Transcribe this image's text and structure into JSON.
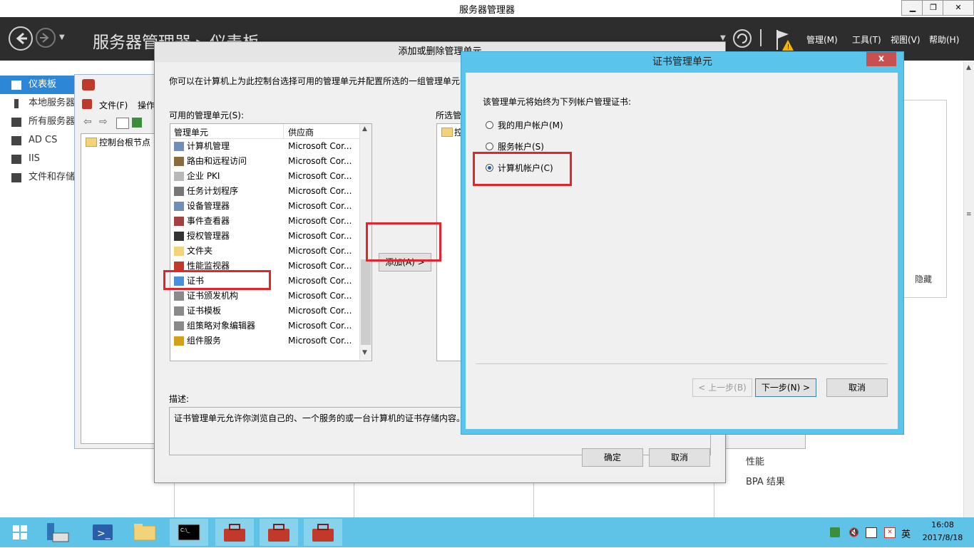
{
  "window": {
    "title": "服务器管理器"
  },
  "header": {
    "title": "服务器管理器 ▸ 仪表板",
    "menus": [
      "管理(M)",
      "工具(T)",
      "视图(V)",
      "帮助(H)"
    ]
  },
  "nav": {
    "items": [
      "仪表板",
      "本地服务器",
      "所有服务器",
      "AD CS",
      "IIS",
      "文件和存储服务"
    ]
  },
  "bg": {
    "hide_label": "隐藏",
    "perf": "性能",
    "bpa": "BPA 结果"
  },
  "mmc": {
    "menu_file": "文件(F)",
    "menu_action": "操作",
    "tree_root": "控制台根节点"
  },
  "addremove": {
    "title": "添加或删除管理单元",
    "intro": "你可以在计算机上为此控制台选择可用的管理单元并配置所选的一组管理单元",
    "available_label": "可用的管理单元(S):",
    "selected_label": "所选管",
    "selected_item": "控",
    "col_snapin": "管理单元",
    "col_vendor": "供应商",
    "snapins": [
      {
        "name": "计算机管理",
        "vendor": "Microsoft Cor..."
      },
      {
        "name": "路由和远程访问",
        "vendor": "Microsoft Cor..."
      },
      {
        "name": "企业 PKI",
        "vendor": "Microsoft Cor..."
      },
      {
        "name": "任务计划程序",
        "vendor": "Microsoft Cor..."
      },
      {
        "name": "设备管理器",
        "vendor": "Microsoft Cor..."
      },
      {
        "name": "事件查看器",
        "vendor": "Microsoft Cor..."
      },
      {
        "name": "授权管理器",
        "vendor": "Microsoft Cor..."
      },
      {
        "name": "文件夹",
        "vendor": "Microsoft Cor..."
      },
      {
        "name": "性能监视器",
        "vendor": "Microsoft Cor..."
      },
      {
        "name": "证书",
        "vendor": "Microsoft Cor..."
      },
      {
        "name": "证书颁发机构",
        "vendor": "Microsoft Cor..."
      },
      {
        "name": "证书模板",
        "vendor": "Microsoft Cor..."
      },
      {
        "name": "组策略对象编辑器",
        "vendor": "Microsoft Cor..."
      },
      {
        "name": "组件服务",
        "vendor": "Microsoft Cor..."
      }
    ],
    "add_button": "添加(A) >",
    "desc_label": "描述:",
    "desc_text": "证书管理单元允许你浏览自己的、一个服务的或一台计算机的证书存储内容。",
    "ok": "确定",
    "cancel": "取消"
  },
  "cert": {
    "title": "证书管理单元",
    "close": "x",
    "prompt": "该管理单元将始终为下列帐户管理证书:",
    "options": [
      "我的用户帐户(M)",
      "服务帐户(S)",
      "计算机帐户(C)"
    ],
    "selected_option": "计算机帐户(C)",
    "back": "< 上一步(B)",
    "next": "下一步(N) >",
    "cancel": "取消"
  },
  "taskbar": {
    "time": "16:08",
    "date": "2017/8/18",
    "ime": "英"
  },
  "colors": {
    "accent": "#2e86d6",
    "highlight_box": "#e3242b",
    "dialog_frame": "#5bc4eb",
    "taskbar": "#5fc3e7"
  }
}
